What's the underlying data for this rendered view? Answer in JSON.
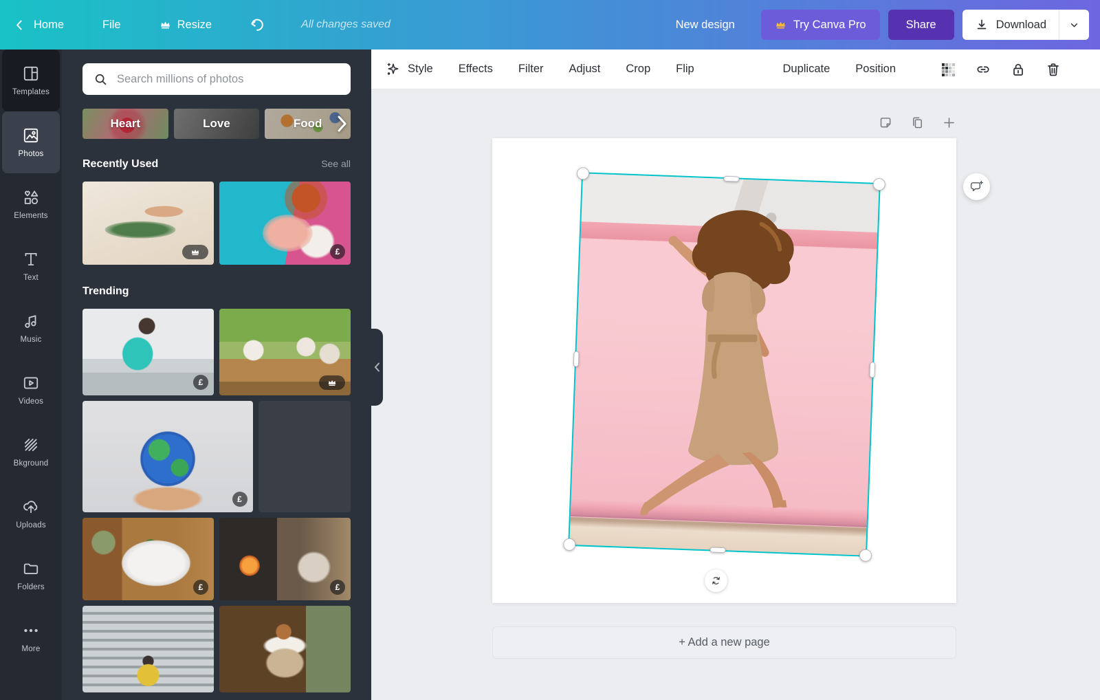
{
  "topbar": {
    "home": "Home",
    "file": "File",
    "resize": "Resize",
    "saved": "All changes saved",
    "new_design": "New design",
    "try_pro": "Try Canva Pro",
    "share": "Share",
    "download": "Download",
    "colors": {
      "gradient_start": "#19c2c6",
      "gradient_end": "#6e66e0",
      "share_bg": "#5732b0",
      "pro_bg": "#6d5cd9",
      "crown_gold": "#f5b942"
    }
  },
  "sidebar": {
    "active": "Photos",
    "items": [
      {
        "label": "Templates",
        "icon": "templates"
      },
      {
        "label": "Photos",
        "icon": "photos"
      },
      {
        "label": "Elements",
        "icon": "elements"
      },
      {
        "label": "Text",
        "icon": "text"
      },
      {
        "label": "Music",
        "icon": "music"
      },
      {
        "label": "Videos",
        "icon": "videos"
      },
      {
        "label": "Bkground",
        "icon": "background"
      },
      {
        "label": "Uploads",
        "icon": "uploads"
      },
      {
        "label": "Folders",
        "icon": "folders"
      },
      {
        "label": "More",
        "icon": "more"
      }
    ]
  },
  "panel": {
    "search_placeholder": "Search millions of photos",
    "chips": [
      {
        "label": "Heart"
      },
      {
        "label": "Love"
      },
      {
        "label": "Food"
      }
    ],
    "recently_used": {
      "title": "Recently Used",
      "action": "See all",
      "photos": [
        {
          "name": "hand-holding-palm-leaf",
          "badge": "crown"
        },
        {
          "name": "woman-with-rose-bouquet",
          "badge": "£"
        }
      ]
    },
    "trending": {
      "title": "Trending",
      "photos": [
        {
          "name": "man-preparing-food-kitchen",
          "badge": "£"
        },
        {
          "name": "friends-outdoor-dinner",
          "badge": "crown"
        },
        {
          "name": "hands-holding-earth-globe",
          "badge": "£"
        },
        {
          "name": "woman-back-pink-wall",
          "badge": ""
        },
        {
          "name": "washing-greens-kitchen-sink",
          "badge": "£"
        },
        {
          "name": "woman-by-fireplace",
          "badge": "£"
        },
        {
          "name": "person-yellow-jacket-blinds",
          "badge": ""
        },
        {
          "name": "barista-in-apron",
          "badge": ""
        }
      ]
    }
  },
  "canvas_toolbar": {
    "menu": [
      {
        "label": "Style",
        "icon": "style"
      },
      {
        "label": "Effects"
      },
      {
        "label": "Filter"
      },
      {
        "label": "Adjust"
      },
      {
        "label": "Crop"
      },
      {
        "label": "Flip"
      }
    ],
    "right_menu": [
      "Duplicate",
      "Position"
    ],
    "icon_buttons": [
      "transparency",
      "link",
      "lock",
      "delete"
    ]
  },
  "canvas": {
    "photo_name": "woman-jumping-pink-backdrop",
    "selection_color": "#00c4cc",
    "add_page": "+ Add a new page"
  }
}
